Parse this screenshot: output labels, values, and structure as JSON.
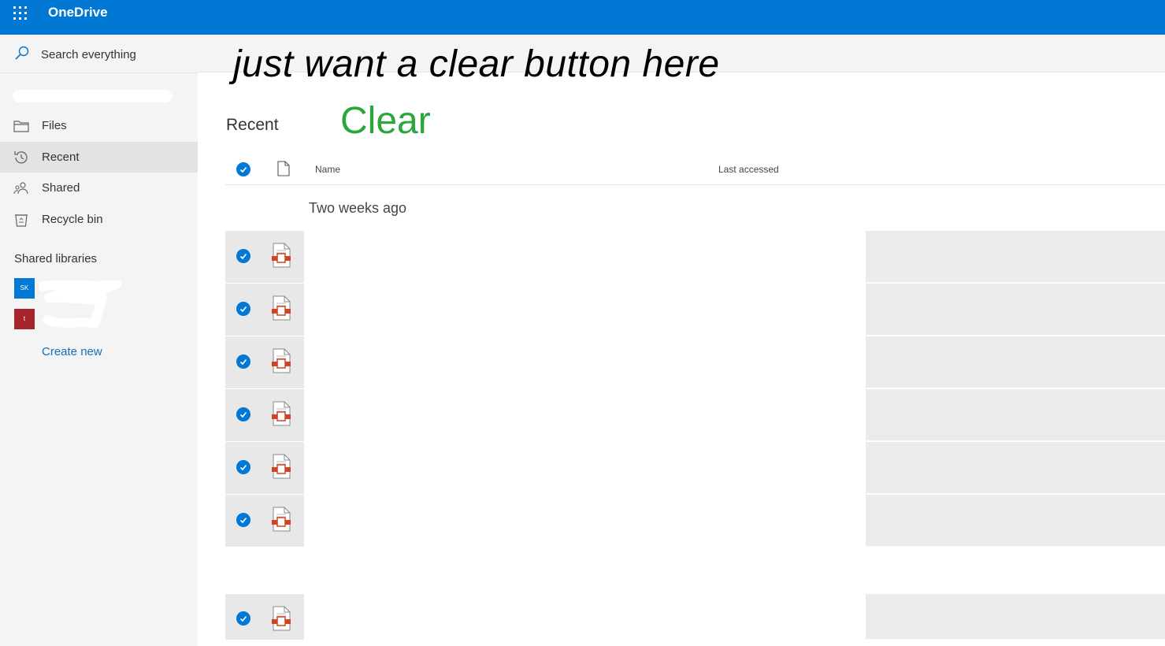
{
  "app": {
    "brand": "OneDrive",
    "waffle_icon": "app-launcher-icon"
  },
  "colors": {
    "accent": "#0078d4",
    "clear_green": "#2aa63a",
    "link": "#106ebe",
    "ppt_red": "#d04423"
  },
  "search": {
    "label": "Search everything",
    "icon": "search-icon"
  },
  "nav": {
    "items": [
      {
        "label": "Files",
        "icon": "folder-icon",
        "selected": false
      },
      {
        "label": "Recent",
        "icon": "history-icon",
        "selected": true
      },
      {
        "label": "Shared",
        "icon": "people-icon",
        "selected": false
      },
      {
        "label": "Recycle bin",
        "icon": "recycle-bin-icon",
        "selected": false
      }
    ],
    "libraries_heading": "Shared libraries",
    "libraries": [
      {
        "initials": "SK",
        "color": "#0078d4"
      },
      {
        "initials": "t",
        "color": "#a4262c"
      }
    ],
    "create_new": "Create new"
  },
  "annotation": {
    "text": "just want a clear button here"
  },
  "page": {
    "title": "Recent",
    "clear_label": "Clear"
  },
  "table": {
    "columns": {
      "name": "Name",
      "last_accessed": "Last accessed"
    },
    "group_label": "Two weeks ago",
    "row_count": 7,
    "file_icon": "powerpoint-file-icon"
  }
}
